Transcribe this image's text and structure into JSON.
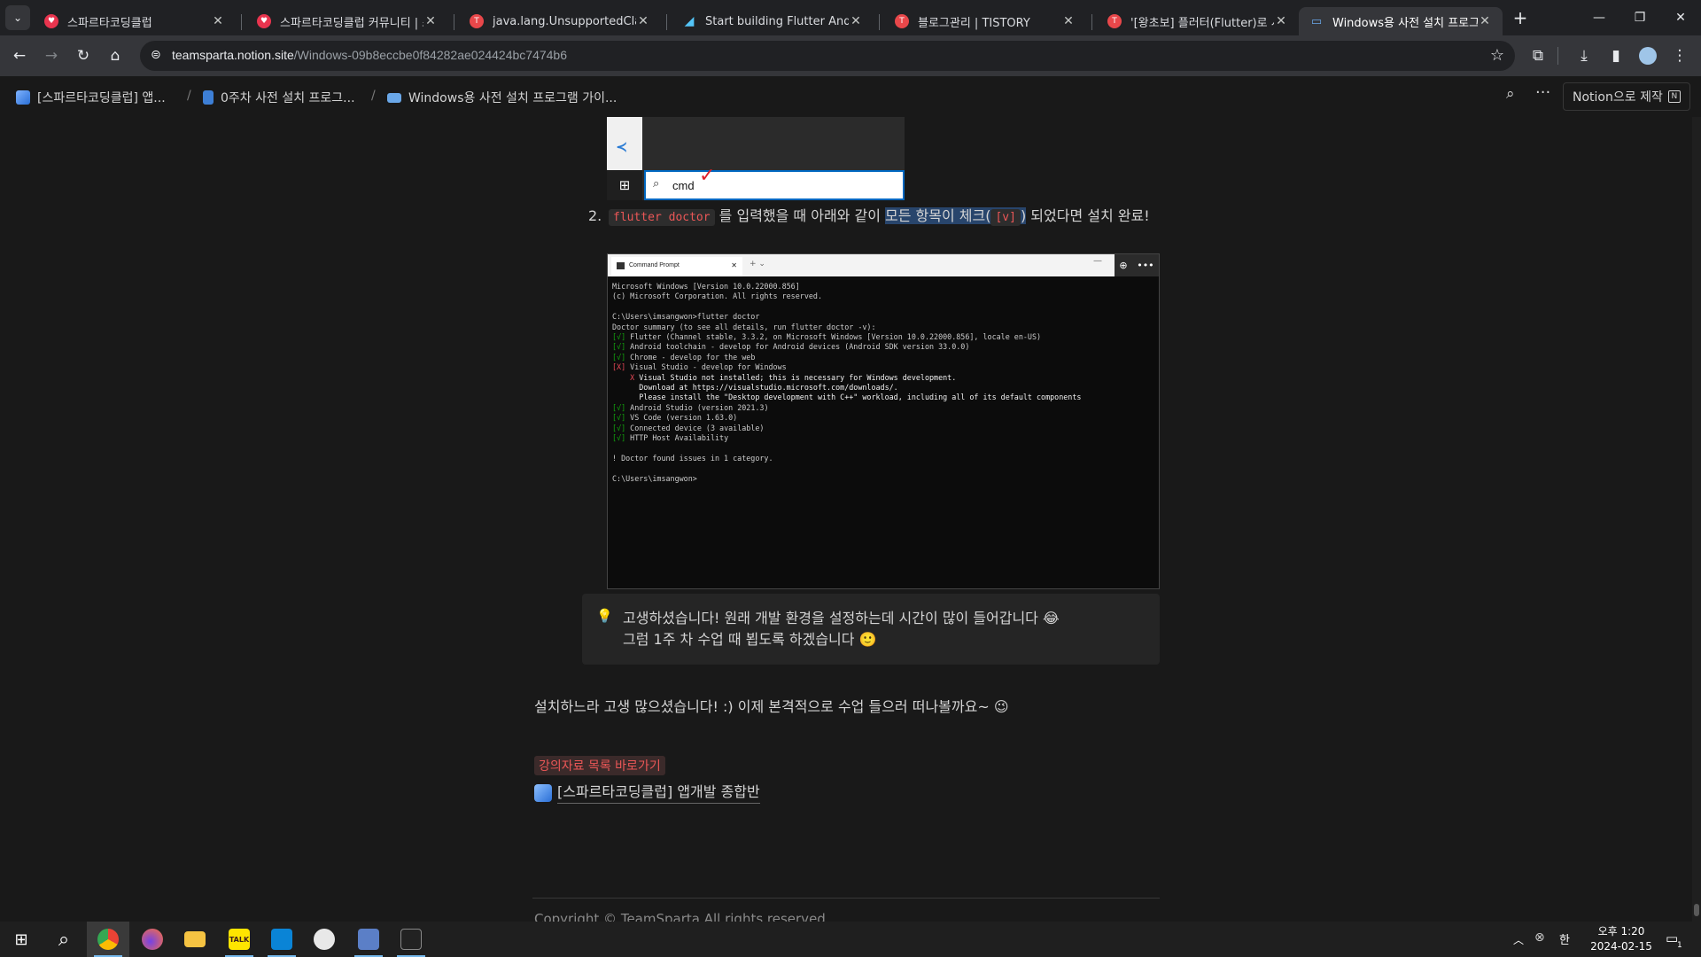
{
  "tabs": [
    {
      "title": "스파르타코딩클럽",
      "close": "✕"
    },
    {
      "title": "스파르타코딩클럽 커뮤니티 | 스",
      "close": "✕"
    },
    {
      "title": "java.lang.UnsupportedClassVer",
      "close": "✕"
    },
    {
      "title": "Start building Flutter Android",
      "close": "✕"
    },
    {
      "title": "블로그관리 | TISTORY",
      "close": "✕"
    },
    {
      "title": "'[왕초보] 플러터(Flutter)로 시작",
      "close": "✕"
    },
    {
      "title": "Windows용 사전 설치 프로그",
      "close": "✕"
    }
  ],
  "new_tab": "+",
  "url_domain": "teamsparta.notion.site",
  "url_path": "/Windows-09b8eccbe0f84282ae024424bc7474b6",
  "breadcrumbs": [
    "[스파르타코딩클럽] 앱...",
    "0주차 사전 설치 프로그...",
    "Windows용 사전 설치 프로그램 가이..."
  ],
  "breadcrumb_sep": "/",
  "notion_button": "Notion으로 제작",
  "search_image": {
    "query": "cmd"
  },
  "step2": {
    "number": "2.",
    "code": "flutter doctor",
    "text_a": " 를 입력했을 때 아래와 같이 ",
    "highlight_a": "모든 항목이 체크(",
    "highlight_code": "[v]",
    "highlight_b": ")",
    "text_b": " 되었다면 설치 완료!"
  },
  "terminal": {
    "tab_title": "Command Prompt",
    "lines": [
      {
        "t": "Microsoft Windows [Version 10.0.22000.856]"
      },
      {
        "t": "(c) Microsoft Corporation. All rights reserved."
      },
      {
        "t": ""
      },
      {
        "t": "C:\\Users\\imsangwon>flutter doctor"
      },
      {
        "t": "Doctor summary (to see all details, run flutter doctor -v):"
      },
      {
        "m": "[√]",
        "c": "g",
        "t": " Flutter (Channel stable, 3.3.2, on Microsoft Windows [Version 10.0.22000.856], locale en-US)"
      },
      {
        "m": "[√]",
        "c": "g",
        "t": " Android toolchain - develop for Android devices (Android SDK version 33.0.0)"
      },
      {
        "m": "[√]",
        "c": "g",
        "t": " Chrome - develop for the web"
      },
      {
        "m": "[X]",
        "c": "r",
        "t": " Visual Studio - develop for Windows"
      },
      {
        "m": "    X",
        "c": "r",
        "t": " Visual Studio not installed; this is necessary for Windows development.",
        "bright": true
      },
      {
        "t": "      Download at https://visualstudio.microsoft.com/downloads/.",
        "bright": true
      },
      {
        "t": "      Please install the \"Desktop development with C++\" workload, including all of its default components",
        "bright": true
      },
      {
        "m": "[√]",
        "c": "g",
        "t": " Android Studio (version 2021.3)"
      },
      {
        "m": "[√]",
        "c": "g",
        "t": " VS Code (version 1.63.0)"
      },
      {
        "m": "[√]",
        "c": "g",
        "t": " Connected device (3 available)"
      },
      {
        "m": "[√]",
        "c": "g",
        "t": " HTTP Host Availability"
      },
      {
        "t": ""
      },
      {
        "t": "! Doctor found issues in 1 category."
      },
      {
        "t": ""
      },
      {
        "t": "C:\\Users\\imsangwon>"
      }
    ]
  },
  "callout": {
    "icon": "💡",
    "line1": "고생하셨습니다! 원래 개발 환경을 설정하는데 시간이 많이 들어갑니다 😂",
    "line2": "그럼 1주 차 수업 때 뵙도록 하겠습니다 🙂"
  },
  "closing_text": "설치하느라 고생 많으셨습니다! :) 이제 본격적으로 수업 들으러 떠나볼까요~ 😉",
  "link_label": "강의자료 목록 바로가기",
  "page_link": "[스파르타코딩클럽] 앱개발 종합반",
  "footer": "Copyright © TeamSparta All rights reserved.",
  "clock": {
    "ampm_time": "오후 1:20",
    "date": "2024-02-15"
  },
  "ime": "한",
  "notif_count": "1",
  "colors": {
    "accent_red": "#eb5757",
    "highlight_blue": "#28456c",
    "page_bg": "#191919"
  }
}
